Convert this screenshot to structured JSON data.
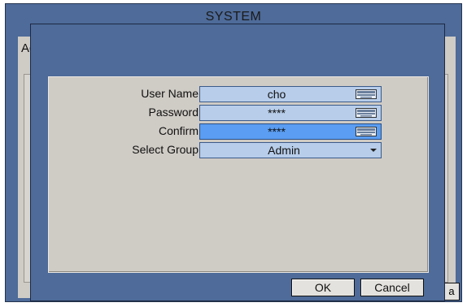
{
  "background_window": {
    "title": "SYSTEM",
    "tab_label": "Ad",
    "corner_button_label": "a"
  },
  "dialog": {
    "fields": {
      "user_name": {
        "label": "User Name",
        "value": "cho",
        "icon": "keyboard-icon"
      },
      "password": {
        "label": "Password",
        "value": "****",
        "icon": "keyboard-icon"
      },
      "confirm": {
        "label": "Confirm",
        "value": "****",
        "icon": "keyboard-icon",
        "active": true
      },
      "select_group": {
        "label": "Select Group",
        "value": "Admin",
        "icon": "chevron-down-icon"
      }
    },
    "buttons": {
      "ok": "OK",
      "cancel": "Cancel"
    }
  },
  "colors": {
    "window": "#4e6b99",
    "panel": "#cfcbc5",
    "field": "#b7cdea",
    "field_active": "#5a9df2"
  }
}
